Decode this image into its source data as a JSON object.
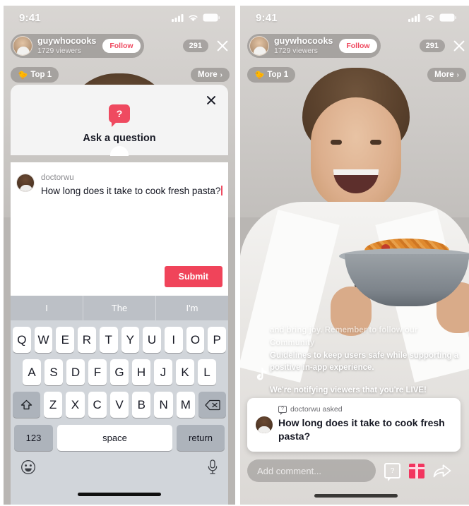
{
  "status_bar": {
    "time": "9:41",
    "signal_icon": "cellular-signal-icon",
    "wifi_icon": "wifi-icon",
    "battery_icon": "battery-icon"
  },
  "header": {
    "username": "guywhocooks",
    "viewers": "1729 viewers",
    "follow_label": "Follow",
    "like_count": "291",
    "close_icon": "close-icon",
    "rank_chip": "Top 1",
    "rank_emoji": "🐤",
    "more_label": "More",
    "more_chevron": "›"
  },
  "left_panel": {
    "sheet": {
      "icon": "question-bubble-icon",
      "icon_glyph": "?",
      "title": "Ask a question",
      "close_icon": "close-icon"
    },
    "compose": {
      "author": "doctorwu",
      "text": "How long does it take to cook fresh pasta?",
      "submit_label": "Submit"
    },
    "keyboard": {
      "suggestions": [
        "I",
        "The",
        "I'm"
      ],
      "row1": [
        "Q",
        "W",
        "E",
        "R",
        "T",
        "Y",
        "U",
        "I",
        "O",
        "P"
      ],
      "row2": [
        "A",
        "S",
        "D",
        "F",
        "G",
        "H",
        "J",
        "K",
        "L"
      ],
      "row3": [
        "Z",
        "X",
        "C",
        "V",
        "B",
        "N",
        "M"
      ],
      "shift_icon": "shift-icon",
      "backspace_icon": "backspace-icon",
      "numbers_label": "123",
      "space_label": "space",
      "return_label": "return",
      "emoji_icon": "emoji-icon",
      "mic_icon": "microphone-icon"
    }
  },
  "right_panel": {
    "live_notice": {
      "guidelines_line1": "and bring joy. Remember to follow our Community",
      "guidelines_line2": "Guidelines to keep users safe while supporting a",
      "guidelines_line3": "positive in-app experience.",
      "notify": "We're notifying viewers that you're LIVE!",
      "logo_icon": "tiktok-logo-icon"
    },
    "question_card": {
      "kicker_icon": "question-bubble-icon",
      "kicker": "doctorwu asked",
      "question": "How long does it take to cook fresh pasta?"
    },
    "bottom_bar": {
      "comment_placeholder": "Add comment...",
      "question_icon": "question-bubble-icon",
      "gift_icon": "gift-icon",
      "share_icon": "share-arrow-icon"
    }
  },
  "colors": {
    "accent_red": "#ef4a60",
    "submit_red": "#f0445a",
    "gift_pink": "#f2355f",
    "keyboard_bg": "#d1d5da",
    "key_gray": "#adb3bb",
    "suggest_bg": "#bcc0c6",
    "sheet_bg": "#f4f4f4",
    "text_dark": "#161823"
  }
}
